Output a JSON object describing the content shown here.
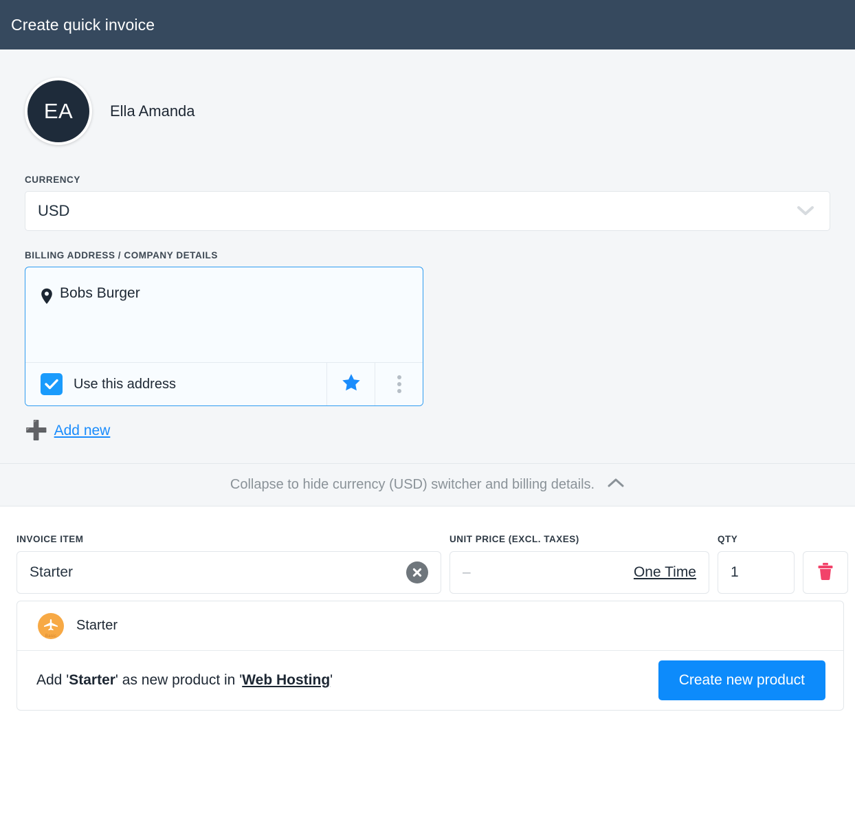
{
  "window": {
    "title": "Create quick invoice",
    "header_bg": "#36495e"
  },
  "customer": {
    "initials": "EA",
    "name": "Ella Amanda"
  },
  "currency": {
    "label": "CURRENCY",
    "value": "USD",
    "chevron_icon": "chevron-down-icon"
  },
  "billing": {
    "label": "BILLING ADDRESS / COMPANY DETAILS",
    "card": {
      "pin_icon": "location-pin-icon",
      "title": "Bobs Burger",
      "checkbox_label": "Use this address",
      "checkbox_checked": true,
      "star_icon": "star-icon",
      "more_icon": "kebab-menu-icon",
      "accent": "#2e9bf0"
    },
    "add_new_label": "Add new",
    "add_new_icon": "plus-icon"
  },
  "collapse": {
    "text": "Collapse to hide currency (USD) switcher and billing details.",
    "icon": "chevron-up-icon"
  },
  "items": {
    "columns": {
      "item": "INVOICE ITEM",
      "unit_price": "UNIT PRICE (EXCL. TAXES)",
      "qty": "QTY"
    },
    "row": {
      "item_value": "Starter",
      "clear_icon": "clear-circle-x-icon",
      "price_placeholder": "–",
      "price_mode": "One Time",
      "qty_value": "1",
      "delete_icon": "trash-icon",
      "delete_color": "#f2436a"
    },
    "suggestions": [
      {
        "name": "Starter",
        "badge_icon": "airplane-icon",
        "badge_tier": "Basic",
        "badge_color": "#f7a945"
      }
    ],
    "footer": {
      "prefix": "Add '",
      "product": "Starter",
      "middle": "' as new product in '",
      "category": "Web Hosting",
      "suffix": "'",
      "button_label": "Create new product",
      "button_color": "#0d8bfb"
    }
  }
}
